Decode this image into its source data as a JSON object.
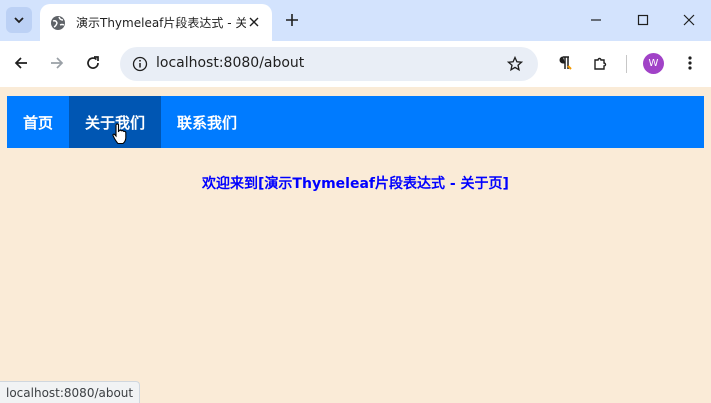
{
  "browser": {
    "tab": {
      "title": "演示Thymeleaf片段表达式 - 关于页"
    },
    "address_bar": {
      "url": "localhost:8080/about"
    },
    "profile": {
      "initial": "W",
      "color": "#a142c7"
    },
    "status_bar": {
      "text": "localhost:8080/about"
    }
  },
  "page": {
    "nav": {
      "items": [
        {
          "label": "首页",
          "active": false
        },
        {
          "label": "关于我们",
          "active": true
        },
        {
          "label": "联系我们",
          "active": false
        }
      ],
      "color": "#007bff",
      "active_color": "#0056b3"
    },
    "heading": "欢迎来到[演示Thymeleaf片段表达式 - 关于页]",
    "heading_color": "#0000ff",
    "background": "#faebd7"
  },
  "icons": {
    "tab_search": "chevron-down-icon",
    "favicon": "globe-icon",
    "tab_close": "close-icon",
    "new_tab": "plus-icon",
    "minimize": "minimize-icon",
    "maximize": "maximize-icon",
    "close_window": "close-icon",
    "back": "back-arrow-icon",
    "forward": "forward-arrow-icon",
    "reload": "reload-icon",
    "site_info": "info-icon",
    "bookmark": "star-icon",
    "reading_mode": "paragraph-icon",
    "extensions": "puzzle-icon",
    "menu": "kebab-menu-icon"
  }
}
